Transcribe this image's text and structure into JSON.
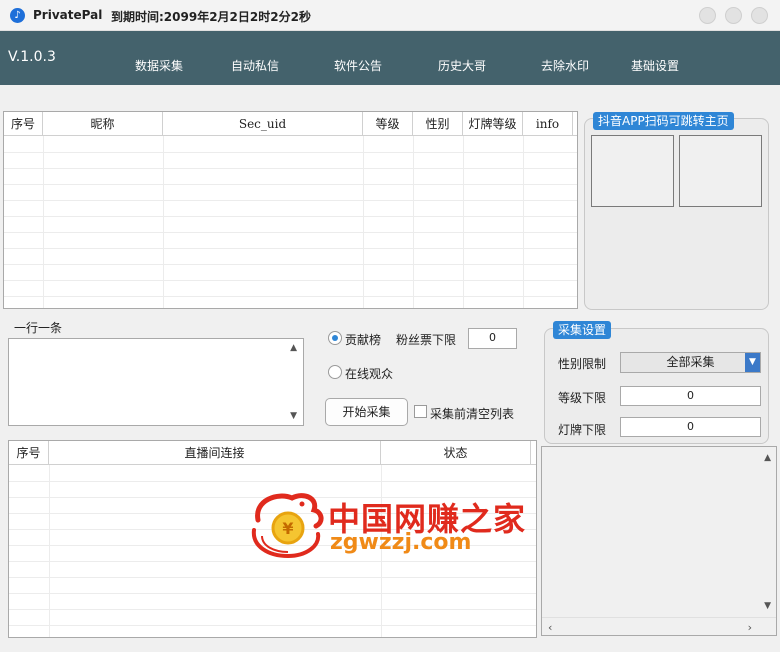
{
  "window": {
    "app_name": "PrivatePal",
    "expire_text": "到期时间:2099年2月2日2时2分2秒"
  },
  "navbar": {
    "version": "V.1.0.3",
    "items": [
      "数据采集",
      "自动私信",
      "软件公告",
      "历史大哥",
      "去除水印",
      "基础设置"
    ]
  },
  "top_table": {
    "columns": [
      "序号",
      "昵称",
      "Sec_uid",
      "等级",
      "性别",
      "灯牌等级",
      "info"
    ],
    "rows": []
  },
  "qr_group": {
    "title": "抖音APP扫码可跳转主页"
  },
  "one_per_line": {
    "label": "一行一条",
    "value": ""
  },
  "collect_options": {
    "radio_contrib": "贡献榜",
    "radio_online": "在线观众",
    "selected": "贡献榜",
    "fans_vote_label": "粉丝票下限",
    "fans_vote_value": "0",
    "start_button": "开始采集",
    "clear_checkbox_label": "采集前清空列表",
    "clear_checked": false
  },
  "collect_settings": {
    "title": "采集设置",
    "gender_label": "性别限制",
    "gender_value": "全部采集",
    "level_label": "等级下限",
    "level_value": "0",
    "badge_label": "灯牌下限",
    "badge_value": "0"
  },
  "bottom_table": {
    "columns": [
      "序号",
      "直播间连接",
      "状态"
    ],
    "rows": []
  },
  "watermark": {
    "title": "中国网赚之家",
    "url": "zgwzzj.com"
  },
  "colors": {
    "navbar": "#44626c",
    "accent": "#2f86d6",
    "watermark_red": "#e02a1d",
    "watermark_orange": "#f08a17"
  }
}
